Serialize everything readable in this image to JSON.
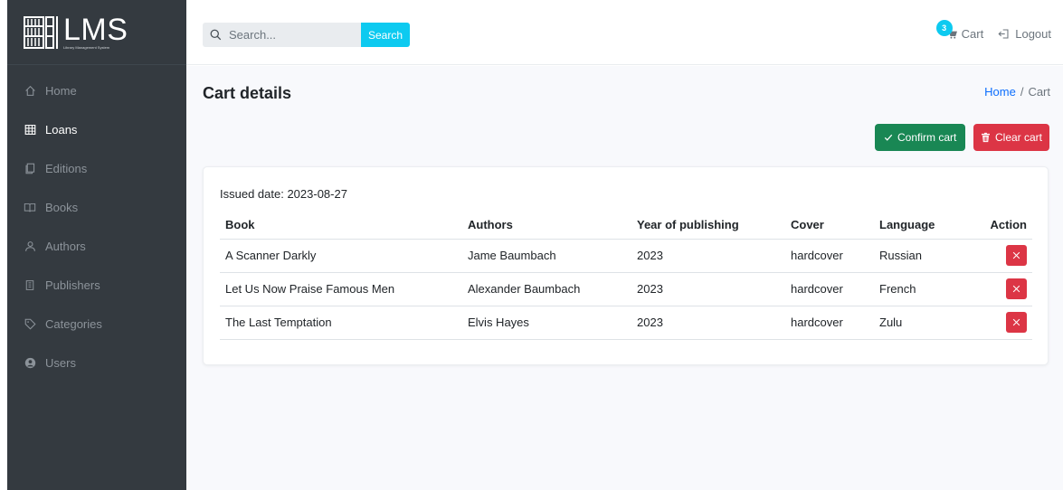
{
  "brand": {
    "title": "LMS",
    "subtitle": "Library Management System"
  },
  "sidebar": {
    "items": [
      {
        "label": "Home",
        "icon": "home-icon"
      },
      {
        "label": "Loans",
        "icon": "table-icon"
      },
      {
        "label": "Editions",
        "icon": "copy-icon"
      },
      {
        "label": "Books",
        "icon": "book-icon"
      },
      {
        "label": "Authors",
        "icon": "person-icon"
      },
      {
        "label": "Publishers",
        "icon": "building-icon"
      },
      {
        "label": "Categories",
        "icon": "tag-icon"
      },
      {
        "label": "Users",
        "icon": "user-circle-icon"
      }
    ],
    "active": "Loans"
  },
  "topbar": {
    "search_placeholder": "Search...",
    "search_button": "Search",
    "cart_count": "3",
    "cart_label": "Cart",
    "logout_label": "Logout"
  },
  "page": {
    "title": "Cart details",
    "breadcrumb": {
      "home": "Home",
      "separator": "/",
      "current": "Cart"
    },
    "confirm_label": "Confirm cart",
    "clear_label": "Clear cart"
  },
  "cart": {
    "issued": "Issued date: 2023-08-27",
    "columns": [
      "Book",
      "Authors",
      "Year of publishing",
      "Cover",
      "Language",
      "Action"
    ],
    "rows": [
      {
        "book": "A Scanner Darkly",
        "authors": "Jame Baumbach",
        "year": "2023",
        "cover": "hardcover",
        "language": "Russian"
      },
      {
        "book": "Let Us Now Praise Famous Men",
        "authors": "Alexander Baumbach",
        "year": "2023",
        "cover": "hardcover",
        "language": "French"
      },
      {
        "book": "The Last Temptation",
        "authors": "Elvis Hayes",
        "year": "2023",
        "cover": "hardcover",
        "language": "Zulu"
      }
    ]
  },
  "colors": {
    "sidebar_bg": "#343a40",
    "info": "#0dcaf0",
    "success": "#198754",
    "danger": "#dc3545",
    "link": "#0d6efd"
  }
}
